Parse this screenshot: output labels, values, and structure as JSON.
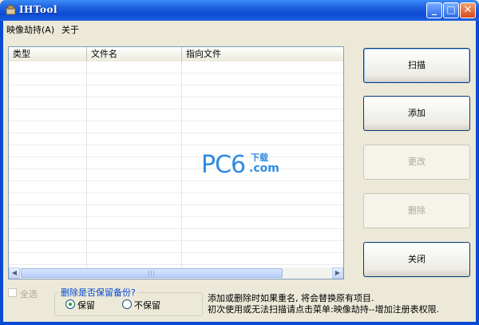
{
  "window": {
    "title": "IHTool",
    "minimize_glyph": "_",
    "maximize_glyph": "□",
    "close_glyph": "✕"
  },
  "menu": {
    "items": [
      {
        "label": "映像劫持(A)"
      },
      {
        "label": "关于"
      }
    ]
  },
  "list": {
    "columns": [
      "类型",
      "文件名",
      "指向文件"
    ],
    "scroll_left": "◀",
    "scroll_right": "▶",
    "scroll_grip": "|||"
  },
  "watermark": {
    "main": "PC6",
    "top": "下载",
    "bottom": ".com",
    "color": "#2f8be0"
  },
  "buttons": {
    "scan": {
      "label": "扫描",
      "enabled": true
    },
    "add": {
      "label": "添加",
      "enabled": true
    },
    "modify": {
      "label": "更改",
      "enabled": false
    },
    "delete": {
      "label": "删除",
      "enabled": false
    },
    "close": {
      "label": "关闭",
      "enabled": true
    }
  },
  "select_all": {
    "label": "全选",
    "checked": false,
    "enabled": false
  },
  "backup": {
    "title": "删除是否保留备份?",
    "options": [
      {
        "label": "保留",
        "selected": true
      },
      {
        "label": "不保留",
        "selected": false
      }
    ]
  },
  "info": {
    "line1": "添加或删除时如果重名, 将会替换原有项目.",
    "line2": "初次使用或无法扫描请点击菜单:映像劫持--增加注册表权限."
  },
  "colors": {
    "title_bar": "#0b4bd4",
    "group_title": "#0046d5",
    "disabled_text": "#aca899"
  }
}
